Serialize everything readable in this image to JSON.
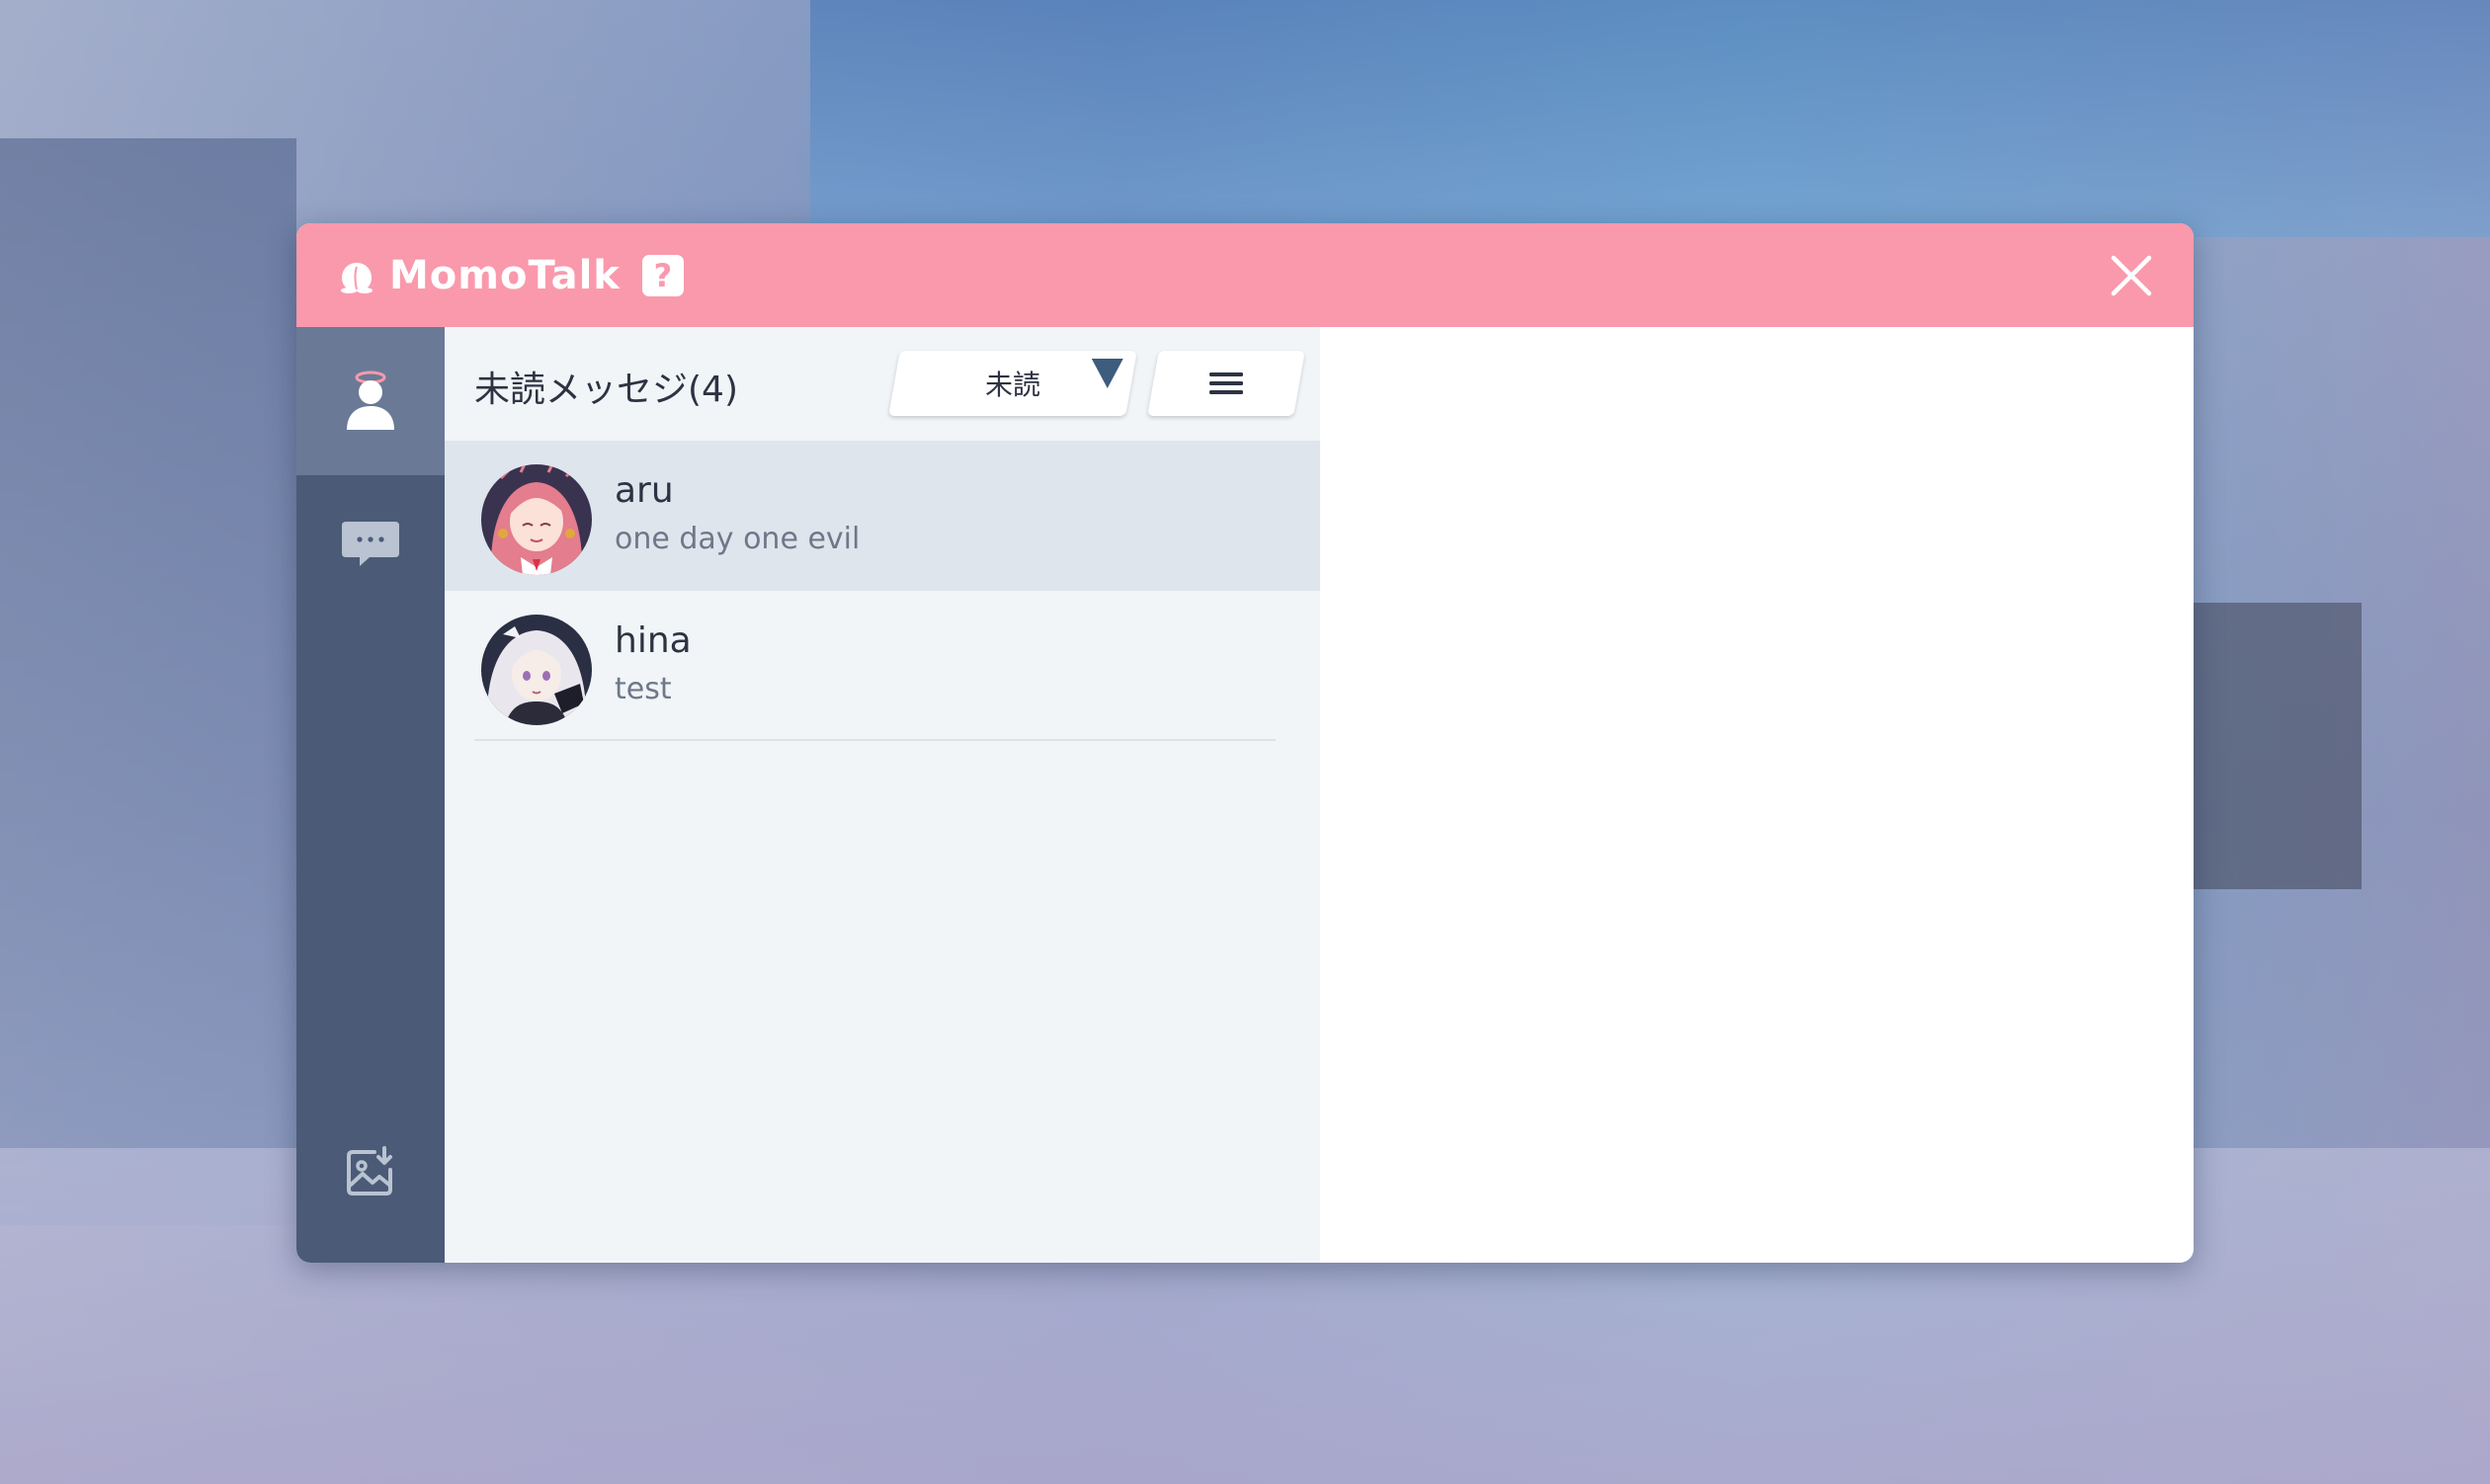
{
  "app": {
    "title": "MomoTalk",
    "help_symbol": "?"
  },
  "colors": {
    "titlebar": "#fa99ac",
    "sidebar": "#4b5b77",
    "sidebar_active": "#6a7a96",
    "list_bg": "#f1f5f8",
    "selected_row": "#dfe5ed",
    "accent_arrow": "#3e5c7e"
  },
  "sidebar": {
    "items": [
      {
        "icon": "student-icon",
        "active": true
      },
      {
        "icon": "chat-bubble-icon",
        "active": false
      },
      {
        "icon": "image-download-icon",
        "active": false
      }
    ]
  },
  "list": {
    "title": "未読メッセジ(4)",
    "sort_label": "未読",
    "menu_icon": "hamburger-menu-icon",
    "contacts": [
      {
        "name": "aru",
        "message": "one day one evil",
        "selected": true
      },
      {
        "name": "hina",
        "message": "test",
        "selected": false
      }
    ]
  }
}
